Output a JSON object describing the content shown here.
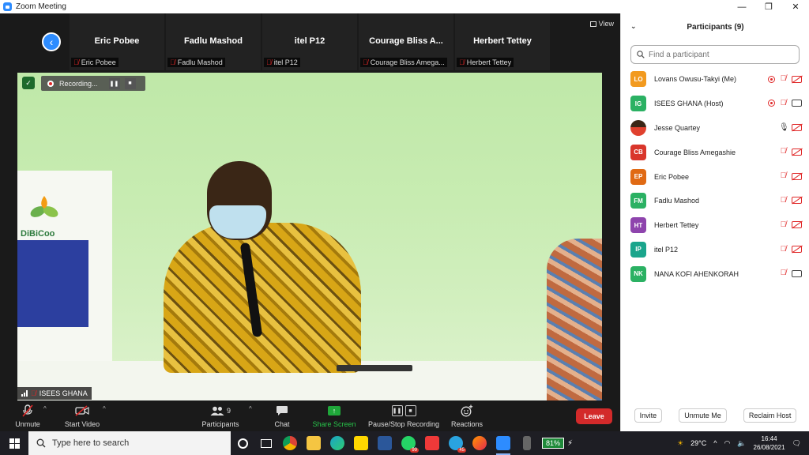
{
  "window": {
    "title": "Zoom Meeting",
    "minimize": "—",
    "maximize": "❐",
    "close": "✕"
  },
  "strip": {
    "view_label": "View",
    "tiles": [
      {
        "name": "Eric Pobee",
        "label": "Eric Pobee"
      },
      {
        "name": "Fadlu Mashod",
        "label": "Fadlu Mashod"
      },
      {
        "name": "itel P12",
        "label": "itel P12"
      },
      {
        "name": "Courage Bliss A...",
        "label": "Courage Bliss Amega..."
      },
      {
        "name": "Herbert Tettey",
        "label": "Herbert Tettey"
      }
    ]
  },
  "video": {
    "recording_label": "Recording...",
    "speaker_name": "ISEES GHANA",
    "banner_logo": "DiBiCoo"
  },
  "toolbar": {
    "unmute": "Unmute",
    "start_video": "Start Video",
    "participants": "Participants",
    "participants_count": "9",
    "chat": "Chat",
    "share_screen": "Share Screen",
    "pause_recording": "Pause/Stop Recording",
    "reactions": "Reactions",
    "leave": "Leave"
  },
  "panel": {
    "title": "Participants (9)",
    "search_placeholder": "Find a participant",
    "participants": [
      {
        "initials": "LO",
        "name": "Lovans Owusu-Takyi (Me)",
        "color": "#f29a1f",
        "recording": true,
        "mic": "off",
        "cam": "off"
      },
      {
        "initials": "IG",
        "name": "ISEES GHANA (Host)",
        "color": "#2bb163",
        "recording": true,
        "mic": "off",
        "cam": "on"
      },
      {
        "initials": "",
        "name": "Jesse Quartey",
        "color": "photo",
        "recording": false,
        "mic": "on",
        "cam": "off"
      },
      {
        "initials": "CB",
        "name": "Courage Bliss Amegashie",
        "color": "#d9362b",
        "recording": false,
        "mic": "off",
        "cam": "off"
      },
      {
        "initials": "EP",
        "name": "Eric Pobee",
        "color": "#e06a14",
        "recording": false,
        "mic": "off",
        "cam": "off"
      },
      {
        "initials": "FM",
        "name": "Fadlu Mashod",
        "color": "#2bb163",
        "recording": false,
        "mic": "off",
        "cam": "off"
      },
      {
        "initials": "HT",
        "name": "Herbert Tettey",
        "color": "#8e44ad",
        "recording": false,
        "mic": "off",
        "cam": "off"
      },
      {
        "initials": "IP",
        "name": "itel P12",
        "color": "#1aa58c",
        "recording": false,
        "mic": "off",
        "cam": "off"
      },
      {
        "initials": "NK",
        "name": "NANA KOFI AHENKORAH",
        "color": "#2bb163",
        "recording": false,
        "mic": "off",
        "cam": "on"
      }
    ],
    "invite": "Invite",
    "unmute_me": "Unmute Me",
    "reclaim_host": "Reclaim Host"
  },
  "taskbar": {
    "search_placeholder": "Type here to search",
    "whatsapp_badge": "99",
    "telegram_badge": "45",
    "battery": "81%",
    "temperature": "29°C",
    "time": "16:44",
    "date": "26/08/2021"
  },
  "colors": {
    "accent": "#2d8cff",
    "leave": "#d32a2a",
    "share": "#1fa73a"
  }
}
